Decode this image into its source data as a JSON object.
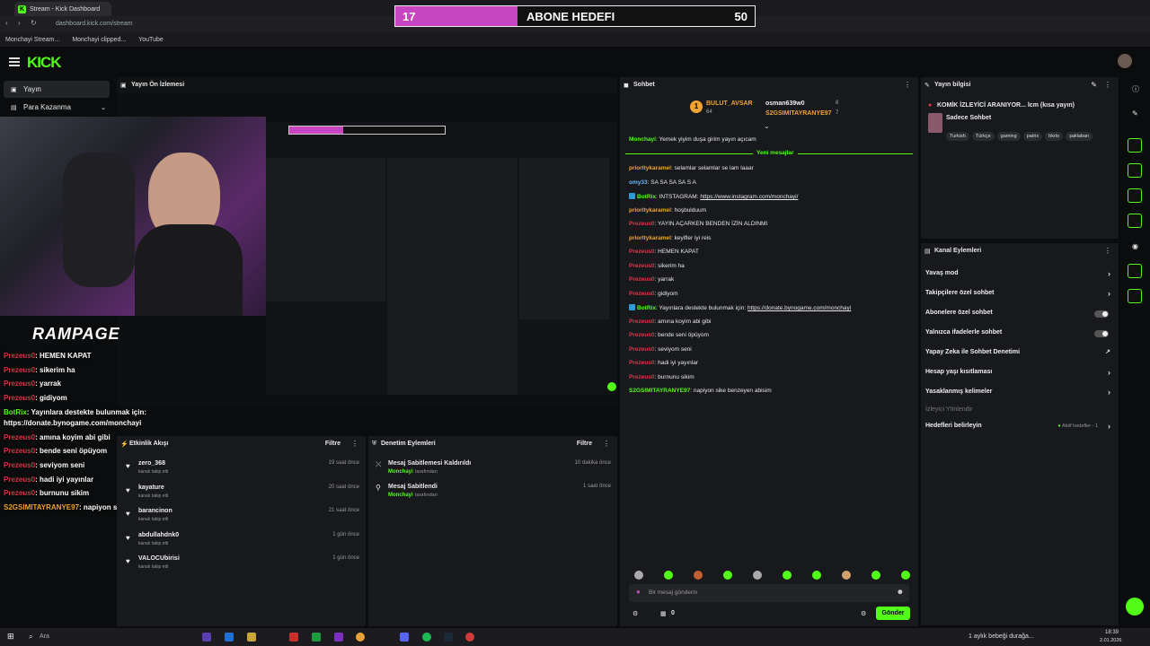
{
  "browser": {
    "tab_title": "Stream - Kick Dashboard",
    "url": "dashboard.kick.com/stream",
    "bookmarks": [
      "Monchayi Stream...",
      "Monchayi clipped...",
      "YouTube"
    ]
  },
  "goal_overlay": {
    "current": "17",
    "title": "ABONE HEDEFI",
    "target": "50",
    "progress": 0.34
  },
  "header": {
    "logo": "KICK"
  },
  "nav": {
    "items": [
      {
        "label": "Yayın"
      },
      {
        "label": "Para Kazanma"
      }
    ]
  },
  "preview": {
    "title": "Yayın Ön İzlemesi"
  },
  "overlay_chat": [
    {
      "user": "Prezeus0",
      "text": "HEMEN KAPAT"
    },
    {
      "user": "Prezeus0",
      "text": "sikerim ha"
    },
    {
      "user": "Prezeus0",
      "text": "yarrak"
    },
    {
      "user": "Prezeus0",
      "text": "gidiyom"
    },
    {
      "user": "BotRix",
      "text": "Yayınlara destekte bulunmak için:"
    },
    {
      "user": "",
      "text": "https://donate.bynogame.com/monchayi"
    },
    {
      "user": "Prezeus0",
      "text": "amına koyim abi gibi"
    },
    {
      "user": "Prezeus0",
      "text": "bende seni öpüyom"
    },
    {
      "user": "Prezeus0",
      "text": "seviyom seni"
    },
    {
      "user": "Prezeus0",
      "text": "hadi iyi yayınlar"
    },
    {
      "user": "Prezeus0",
      "text": "burnunu sikim"
    },
    {
      "user": "S2GSIMITAYRANYE97",
      "text": "napiyon sike benzeyen abisim"
    }
  ],
  "overlay_brand": "RAMPAGE",
  "events": {
    "title": "Etkinlik Akışı",
    "filter": "Filtre",
    "items": [
      {
        "name": "zero_368",
        "sub": "kanalı takip etti",
        "time": "19 saat önce"
      },
      {
        "name": "kayature",
        "sub": "kanalı takip etti",
        "time": "20 saat önce"
      },
      {
        "name": "barancinon",
        "sub": "kanalı takip etti",
        "time": "21 saat önce"
      },
      {
        "name": "abdullahdnk0",
        "sub": "kanalı takip etti",
        "time": "1 gün önce"
      },
      {
        "name": "VALOCUbirisi",
        "sub": "kanalı takip etti",
        "time": "1 gün önce"
      }
    ]
  },
  "mods": {
    "title": "Denetim Eylemleri",
    "filter": "Filtre",
    "items": [
      {
        "name": "Mesaj Sabitlemesi Kaldırıldı",
        "by": "Monchayi",
        "sub": "tarafından",
        "time": "10 dakika önce"
      },
      {
        "name": "Mesaj Sabitlendi",
        "by": "Monchayi",
        "sub": "tarafından",
        "time": "1 saat önce"
      }
    ]
  },
  "chat": {
    "title": "Sohbet",
    "top_gifters": [
      {
        "name": "BULUT_AVSAR",
        "count": "64"
      },
      {
        "name": "osman639w0",
        "count": "8"
      },
      {
        "name": "S2GSIMITAYRANYE97",
        "count": "7"
      }
    ],
    "pinned": {
      "user": "Monchayi",
      "text": "Yemek yiyim duşa girim yayın açıcam"
    },
    "new_messages": "Yeni mesajlar",
    "messages": [
      {
        "user": "priorltykaramel",
        "text": "selamlar selamlar se lam laaar",
        "color": "orange"
      },
      {
        "user": "omy33",
        "text": "SA SA SA SA S A",
        "color": "blue"
      },
      {
        "user": "BotRix",
        "text": "INTSTAGRAM: ",
        "link": "https://www.instagram.com/monchayi/",
        "color": "green"
      },
      {
        "user": "priorltykaramel",
        "text": "hoşbulduum",
        "color": "orange"
      },
      {
        "user": "Prezeus0",
        "text": "YAYIN AÇARKEN BENDEN İZİN ALDINMI",
        "color": "red"
      },
      {
        "user": "priorltykaramel",
        "text": "keyifler iyi reis",
        "color": "orange"
      },
      {
        "user": "Prezeus0",
        "text": "HEMEN KAPAT",
        "color": "red"
      },
      {
        "user": "Prezeus0",
        "text": "sikerim ha",
        "color": "red"
      },
      {
        "user": "Prezeus0",
        "text": "yarrak",
        "color": "red"
      },
      {
        "user": "Prezeus0",
        "text": "gidiyom",
        "color": "red"
      },
      {
        "user": "BotRix",
        "text": "Yayınlara destekte bulunmak için: ",
        "link": "https://donate.bynogame.com/monchayi",
        "color": "green"
      },
      {
        "user": "Prezeus0",
        "text": "amına koyim abi gibi",
        "color": "red"
      },
      {
        "user": "Prezeus0",
        "text": "bende seni öpüyom",
        "color": "red"
      },
      {
        "user": "Prezeus0",
        "text": "seviyom seni",
        "color": "red"
      },
      {
        "user": "Prezeus0",
        "text": "hadi iyi yayınlar",
        "color": "red"
      },
      {
        "user": "Prezeus0",
        "text": "burnunu sikim",
        "color": "red"
      },
      {
        "user": "S2GSIMITAYRANYE97",
        "text": "napiyon sike benzeyen abisim",
        "color": "green"
      }
    ],
    "input_placeholder": "Bir mesaj gönderin",
    "points": "0",
    "send": "Gönder"
  },
  "stream_info": {
    "title": "Yayın bilgisi",
    "stream_title": "KOMİK İZLEYİCİ ARANIYOR... lcm (kısa yayın)",
    "category": "Sadece Sohbet",
    "tags": [
      "Turkish",
      "Türkçe",
      "gaming",
      "patrix",
      "bkrts",
      "şaklaban"
    ]
  },
  "channel_actions": {
    "title": "Kanal Eylemleri",
    "items": [
      {
        "label": "Yavaş mod",
        "kind": "chevron"
      },
      {
        "label": "Takipçilere özel sohbet",
        "kind": "chevron"
      },
      {
        "label": "Abonelere özel sohbet",
        "kind": "toggle"
      },
      {
        "label": "Yalnızca ifadelerle sohbet",
        "kind": "toggle"
      },
      {
        "label": "Yapay Zeka ile Sohbet Denetimi",
        "kind": "external"
      },
      {
        "label": "Hesap yaşı kısıtlaması",
        "kind": "chevron"
      },
      {
        "label": "Yasaklanmış kelimeler",
        "kind": "chevron"
      }
    ],
    "section": "İzleyici Yönlendir",
    "goals_label": "Hedefleri belirleyin",
    "goals_status": "Aktif hedefler - 1"
  },
  "taskbar": {
    "search": "Ara",
    "weather_text": "1 aylık bebeği durağa...",
    "time": "18:39",
    "date": "2.01.2026"
  },
  "colors": {
    "accent": "#53fc18",
    "goal_fill": "#c845c2",
    "danger": "#e0334a",
    "user_orange": "#f0a431"
  }
}
